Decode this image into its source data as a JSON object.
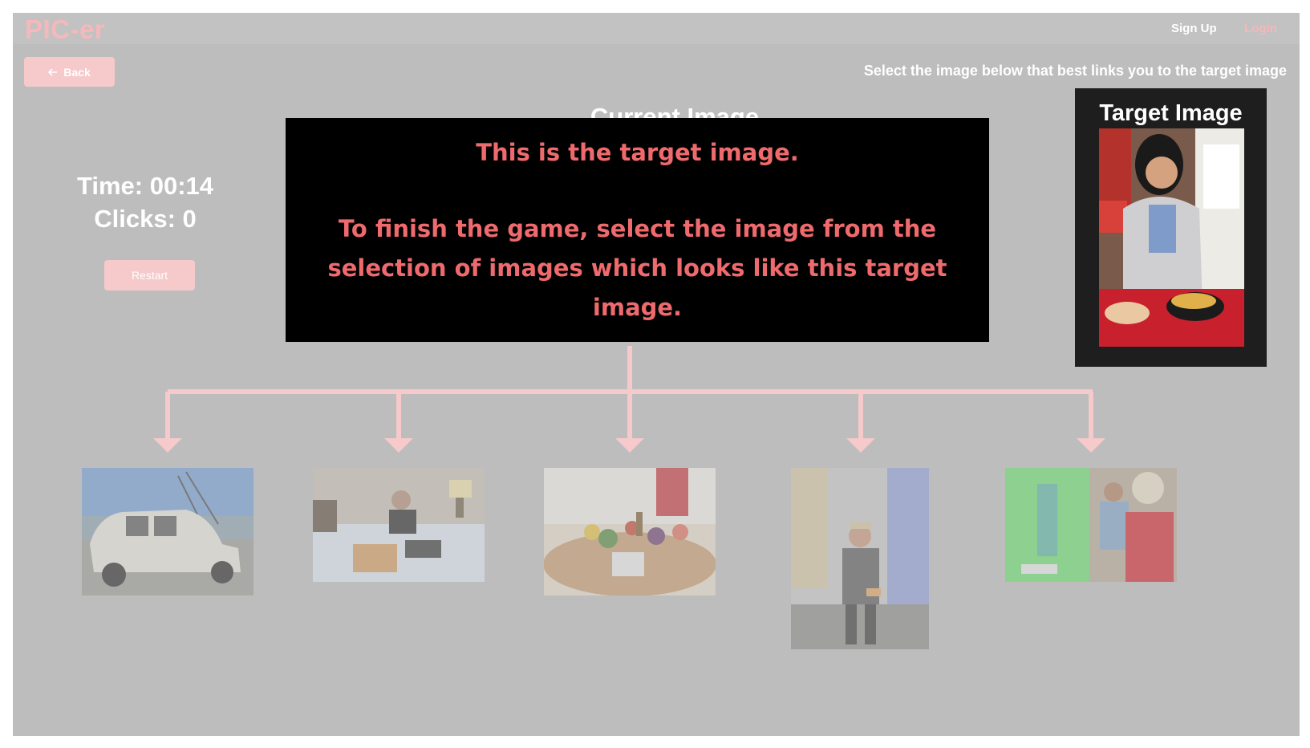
{
  "nav": {
    "brand": "PIC-er",
    "signup": "Sign Up",
    "login": "Login"
  },
  "back_label": "Back",
  "instruction": "Select the image below that best links you to the target image",
  "current_image_title": "Current Image",
  "stats": {
    "time": "Time: 00:14",
    "clicks": "Clicks: 0"
  },
  "restart_label": "Restart",
  "overlay": {
    "line1": "This is the target image.",
    "line2": "To finish the game, select the image from the selection of images which looks like this target image."
  },
  "target": {
    "title": "Target Image"
  },
  "colors": {
    "accent_pink": "#f6b8bb",
    "overlay_text": "#ef6a6d",
    "backdrop": "#bdbdbd"
  }
}
